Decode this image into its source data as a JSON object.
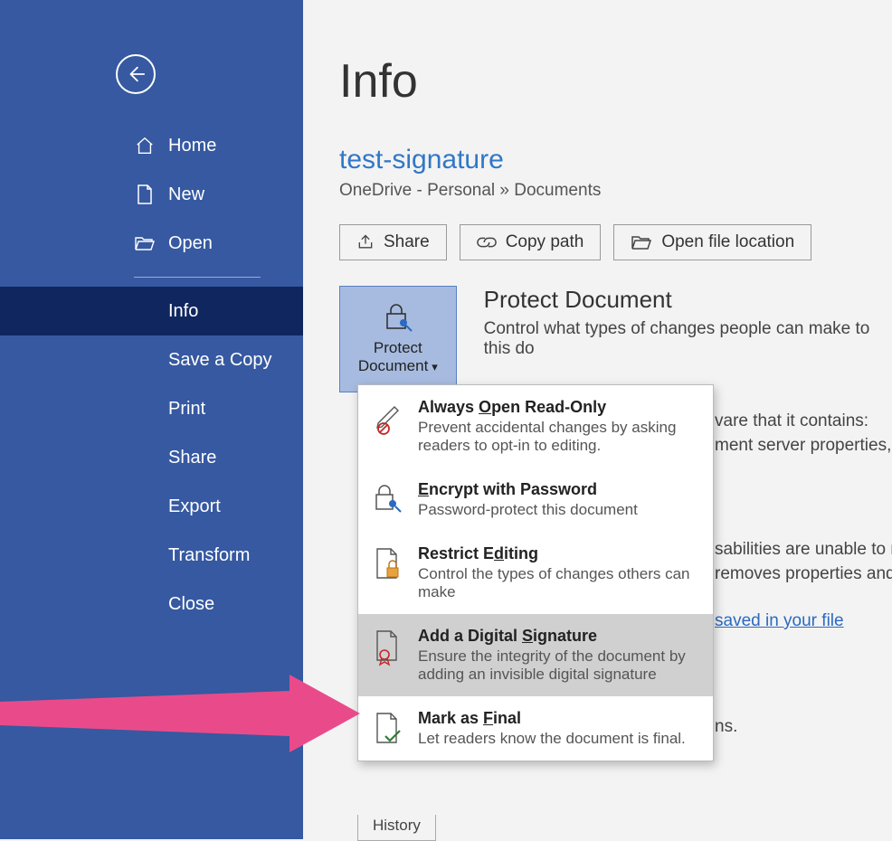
{
  "sidebar": {
    "top": [
      {
        "label": "Home"
      },
      {
        "label": "New"
      },
      {
        "label": "Open"
      }
    ],
    "bottom": [
      {
        "label": "Info",
        "active": true
      },
      {
        "label": "Save a Copy"
      },
      {
        "label": "Print"
      },
      {
        "label": "Share"
      },
      {
        "label": "Export"
      },
      {
        "label": "Transform"
      },
      {
        "label": "Close"
      }
    ]
  },
  "main": {
    "page_title": "Info",
    "doc_title": "test-signature",
    "breadcrumb": "OneDrive - Personal » Documents",
    "actions": {
      "share": "Share",
      "copy_path": "Copy path",
      "open_location": "Open file location"
    },
    "protect": {
      "button_line1": "Protect",
      "button_line2": "Document",
      "heading": "Protect Document",
      "description": "Control what types of changes people can make to this do"
    },
    "menu": [
      {
        "title_pre": "Always ",
        "title_u": "O",
        "title_post": "pen Read-Only",
        "desc": "Prevent accidental changes by asking readers to opt-in to editing."
      },
      {
        "title_pre": "",
        "title_u": "E",
        "title_post": "ncrypt with Password",
        "desc": "Password-protect this document"
      },
      {
        "title_pre": "Restrict E",
        "title_u": "d",
        "title_post": "iting",
        "desc": "Control the types of changes others can make"
      },
      {
        "title_pre": "Add a Digital ",
        "title_u": "S",
        "title_post": "ignature",
        "desc": "Ensure the integrity of the document by adding an invisible digital signature"
      },
      {
        "title_pre": "Mark as ",
        "title_u": "F",
        "title_post": "inal",
        "desc": "Let readers know the document is final."
      }
    ],
    "bg_fragments": {
      "a": "vare that it contains:",
      "b": "ment server properties, cor",
      "c": "sabilities are unable to rea",
      "d": "removes properties and p",
      "e": " saved in your file",
      "f": "ns.",
      "history": "History"
    }
  }
}
